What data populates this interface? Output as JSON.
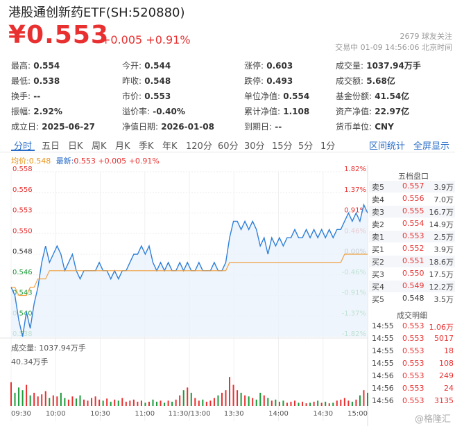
{
  "header": {
    "title": "港股通创新药ETF(SH:520880)",
    "price": "¥0.553",
    "change": "+0.005 +0.91%",
    "followers": "2679 球友关注",
    "status": "交易中 01-09 14:56:06 北京时间"
  },
  "stats": [
    {
      "label": "最高:",
      "value": "0.554",
      "color": "red"
    },
    {
      "label": "今开:",
      "value": "0.544",
      "color": "green"
    },
    {
      "label": "涨停:",
      "value": "0.603",
      "color": "red"
    },
    {
      "label": "成交量:",
      "value": "1037.94万手",
      "color": ""
    },
    {
      "label": "最低:",
      "value": "0.538",
      "color": "green"
    },
    {
      "label": "昨收:",
      "value": "0.548",
      "color": ""
    },
    {
      "label": "跌停:",
      "value": "0.493",
      "color": "green"
    },
    {
      "label": "成交额:",
      "value": "5.68亿",
      "color": ""
    },
    {
      "label": "换手:",
      "value": "--",
      "color": ""
    },
    {
      "label": "市价:",
      "value": "0.553",
      "color": ""
    },
    {
      "label": "单位净值:",
      "value": "0.554",
      "color": ""
    },
    {
      "label": "基金份额:",
      "value": "41.54亿",
      "color": ""
    },
    {
      "label": "振幅:",
      "value": "2.92%",
      "color": ""
    },
    {
      "label": "溢价率:",
      "value": "-0.40%",
      "color": ""
    },
    {
      "label": "累计净值:",
      "value": "1.108",
      "color": ""
    },
    {
      "label": "资产净值:",
      "value": "22.97亿",
      "color": ""
    },
    {
      "label": "成立日:",
      "value": "2025-06-27",
      "color": ""
    },
    {
      "label": "净值日期:",
      "value": "2026-01-08",
      "color": ""
    },
    {
      "label": "到期日:",
      "value": "--",
      "color": ""
    },
    {
      "label": "货币单位:",
      "value": "CNY",
      "color": ""
    }
  ],
  "tabs": [
    "分时",
    "五日",
    "日K",
    "周K",
    "月K",
    "季K",
    "年K",
    "120分",
    "60分",
    "30分",
    "15分",
    "5分",
    "1分"
  ],
  "links": {
    "stats": "区间统计",
    "fullscreen": "全屏显示"
  },
  "legend": {
    "avg": "均价:0.548",
    "latest": "最新:0.553 +0.005 +0.91%"
  },
  "orderbook": {
    "title": "五档盘口",
    "rows": [
      {
        "label": "卖5",
        "price": "0.557",
        "vol": "3.9万"
      },
      {
        "label": "卖4",
        "price": "0.556",
        "vol": "7.0万"
      },
      {
        "label": "卖3",
        "price": "0.555",
        "vol": "16.7万"
      },
      {
        "label": "卖2",
        "price": "0.554",
        "vol": "14.9万"
      },
      {
        "label": "卖1",
        "price": "0.553",
        "vol": "2.5万"
      },
      {
        "label": "买1",
        "price": "0.552",
        "vol": "3.9万"
      },
      {
        "label": "买2",
        "price": "0.551",
        "vol": "18.6万"
      },
      {
        "label": "买3",
        "price": "0.550",
        "vol": "17.5万"
      },
      {
        "label": "买4",
        "price": "0.549",
        "vol": "12.2万"
      },
      {
        "label": "买5",
        "price": "0.548",
        "vol": "3.5万"
      }
    ]
  },
  "trades": {
    "title": "成交明细",
    "rows": [
      {
        "time": "14:55",
        "price": "0.553",
        "vol": "1.06万"
      },
      {
        "time": "14:55",
        "price": "0.553",
        "vol": "5017"
      },
      {
        "time": "14:55",
        "price": "0.553",
        "vol": "18"
      },
      {
        "time": "14:55",
        "price": "0.553",
        "vol": "108"
      },
      {
        "time": "14:56",
        "price": "0.553",
        "vol": "249"
      },
      {
        "time": "14:56",
        "price": "0.553",
        "vol": "24"
      },
      {
        "time": "14:56",
        "price": "0.553",
        "vol": "3135"
      }
    ]
  },
  "volume": {
    "title": "成交量: 1037.94万手",
    "max_label": "40.34万手"
  },
  "watermark": "@格隆汇",
  "chart_data": {
    "type": "line",
    "y_left_ticks": [
      "0.558",
      "0.556",
      "0.553",
      "0.550",
      "0.548",
      "0.546",
      "0.543",
      "0.540",
      "0.538"
    ],
    "y_right_ticks": [
      "1.82%",
      "1.37%",
      "0.91%",
      "0.46%",
      "0.00%",
      "-0.46%",
      "-0.91%",
      "-1.37%",
      "-1.82%"
    ],
    "ylim": [
      0.538,
      0.558
    ],
    "x_ticks": [
      "09:30",
      "10:00",
      "10:30",
      "11:00",
      "11:30/13:00",
      "13:30",
      "14:00",
      "14:30",
      "15:00"
    ],
    "prev_close": 0.548,
    "series": [
      {
        "values": [
          0.544,
          0.543,
          0.54,
          0.538,
          0.541,
          0.539,
          0.542,
          0.544,
          0.547,
          0.549,
          0.547,
          0.548,
          0.549,
          0.548,
          0.546,
          0.547,
          0.548,
          0.546,
          0.545,
          0.546,
          0.546,
          0.546,
          0.546,
          0.547,
          0.546,
          0.546,
          0.545,
          0.546,
          0.545,
          0.546,
          0.546,
          0.547,
          0.548,
          0.548,
          0.549,
          0.548,
          0.549,
          0.547,
          0.546,
          0.547,
          0.546,
          0.547,
          0.546,
          0.546,
          0.547,
          0.546,
          0.547,
          0.546,
          0.546,
          0.547,
          0.546,
          0.546,
          0.546,
          0.547,
          0.546,
          0.546,
          0.547,
          0.55,
          0.552,
          0.552,
          0.551,
          0.552,
          0.551,
          0.552,
          0.551,
          0.549,
          0.55,
          0.548,
          0.55,
          0.549,
          0.55,
          0.549,
          0.55,
          0.55,
          0.551,
          0.55,
          0.55,
          0.551,
          0.55,
          0.551,
          0.55,
          0.551,
          0.55,
          0.551,
          0.55,
          0.551,
          0.551,
          0.552,
          0.553,
          0.552,
          0.553,
          0.552,
          0.554,
          0.553
        ]
      },
      {
        "values": [
          0.544,
          0.544,
          0.543,
          0.543,
          0.543,
          0.544,
          0.544,
          0.545,
          0.545,
          0.545,
          0.546,
          0.546,
          0.546,
          0.546,
          0.546,
          0.546,
          0.546,
          0.546,
          0.546,
          0.546,
          0.546,
          0.546,
          0.546,
          0.546,
          0.546,
          0.546,
          0.546,
          0.546,
          0.546,
          0.546,
          0.546,
          0.546,
          0.546,
          0.546,
          0.546,
          0.546,
          0.546,
          0.546,
          0.546,
          0.546,
          0.546,
          0.546,
          0.546,
          0.546,
          0.546,
          0.546,
          0.546,
          0.546,
          0.546,
          0.546,
          0.546,
          0.546,
          0.546,
          0.546,
          0.546,
          0.546,
          0.546,
          0.547,
          0.547,
          0.547,
          0.547,
          0.547,
          0.547,
          0.547,
          0.547,
          0.547,
          0.547,
          0.547,
          0.547,
          0.547,
          0.547,
          0.547,
          0.547,
          0.547,
          0.547,
          0.547,
          0.547,
          0.547,
          0.547,
          0.547,
          0.547,
          0.547,
          0.547,
          0.547,
          0.547,
          0.547,
          0.547,
          0.548,
          0.548,
          0.548,
          0.548,
          0.548,
          0.548,
          0.548
        ]
      }
    ],
    "volumes": [
      0.45,
      0.25,
      0.35,
      0.3,
      0.4,
      0.2,
      0.25,
      0.18,
      0.22,
      0.28,
      0.15,
      0.2,
      0.18,
      0.25,
      0.15,
      0.12,
      0.18,
      0.14,
      0.2,
      0.12,
      0.1,
      0.15,
      0.18,
      0.12,
      0.1,
      0.14,
      0.08,
      0.12,
      0.1,
      0.15,
      0.08,
      0.1,
      0.12,
      0.08,
      0.1,
      0.06,
      0.08,
      0.12,
      0.08,
      0.1,
      0.06,
      0.1,
      0.08,
      0.12,
      0.2,
      0.3,
      0.35,
      0.25,
      0.15,
      0.1,
      0.12,
      0.08,
      0.1,
      0.15,
      0.2,
      0.25,
      0.3,
      0.55,
      0.4,
      0.3,
      0.25,
      0.2,
      0.18,
      0.15,
      0.12,
      0.25,
      0.2,
      0.15,
      0.1,
      0.12,
      0.08,
      0.1,
      0.06,
      0.08,
      0.1,
      0.06,
      0.08,
      0.05,
      0.06,
      0.08,
      0.1,
      0.06,
      0.08,
      0.05,
      0.06,
      0.1,
      0.12,
      0.15,
      0.1,
      0.08,
      0.12,
      0.2,
      0.3,
      0.25
    ]
  }
}
